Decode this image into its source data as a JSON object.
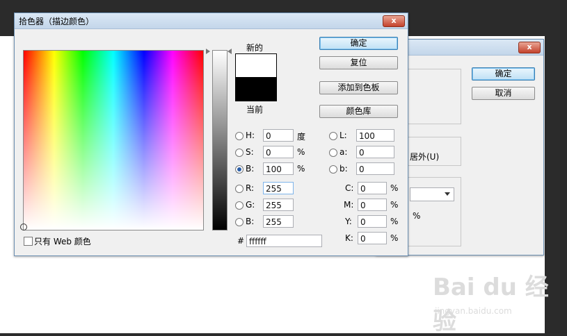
{
  "color_picker": {
    "title": "拾色器（描边颜色）",
    "close_label": "x",
    "new_label": "新的",
    "current_label": "当前",
    "buttons": {
      "ok": "确定",
      "reset": "复位",
      "add_swatch": "添加到色板",
      "libraries": "颜色库"
    },
    "hsb": [
      {
        "label": "H:",
        "value": "0",
        "unit": "度",
        "selected": false
      },
      {
        "label": "S:",
        "value": "0",
        "unit": "%",
        "selected": false
      },
      {
        "label": "B:",
        "value": "100",
        "unit": "%",
        "selected": true
      }
    ],
    "rgb": [
      {
        "label": "R:",
        "value": "255"
      },
      {
        "label": "G:",
        "value": "255"
      },
      {
        "label": "B:",
        "value": "255"
      }
    ],
    "lab": [
      {
        "label": "L:",
        "value": "100"
      },
      {
        "label": "a:",
        "value": "0"
      },
      {
        "label": "b:",
        "value": "0"
      }
    ],
    "cmyk": [
      {
        "label": "C:",
        "value": "0",
        "unit": "%"
      },
      {
        "label": "M:",
        "value": "0",
        "unit": "%"
      },
      {
        "label": "Y:",
        "value": "0",
        "unit": "%"
      },
      {
        "label": "K:",
        "value": "0",
        "unit": "%"
      }
    ],
    "hex_label": "#",
    "hex_value": "ffffff",
    "web_only_label": "只有 Web 颜色",
    "new_color": "#ffffff",
    "current_color": "#000000"
  },
  "back_dialog": {
    "close_label": "x",
    "buttons": {
      "ok": "确定",
      "cancel": "取消"
    },
    "position_text": "居外(U)",
    "percent": "%"
  },
  "watermark": {
    "brand": "Bai du 经验",
    "url": "jingyan.baidu.com"
  }
}
